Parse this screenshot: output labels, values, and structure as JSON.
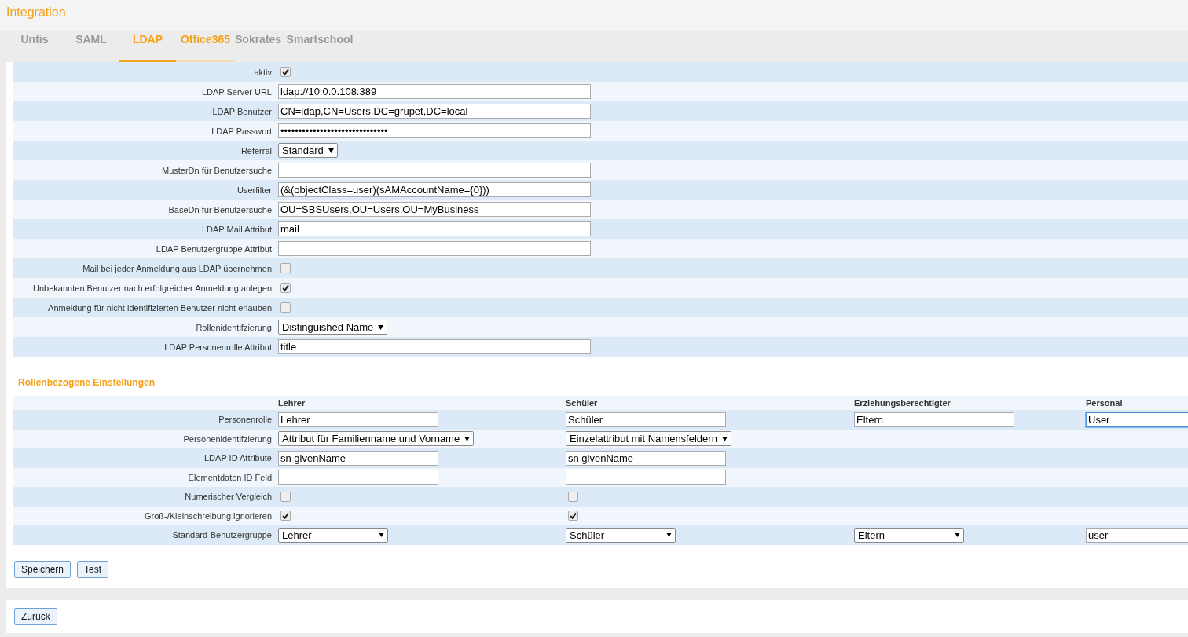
{
  "page_title": "Integration",
  "tabs": [
    {
      "label": "Untis",
      "selected": false,
      "highlighted": false
    },
    {
      "label": "SAML",
      "selected": false,
      "highlighted": false
    },
    {
      "label": "LDAP",
      "selected": true,
      "highlighted": true
    },
    {
      "label": "Office365",
      "selected": false,
      "highlighted": true
    },
    {
      "label": "Sokrates",
      "selected": false,
      "highlighted": false
    },
    {
      "label": "Smartschool",
      "selected": false,
      "highlighted": false
    }
  ],
  "settings": [
    {
      "label": "aktiv",
      "kind": "checkbox",
      "checked": true
    },
    {
      "label": "LDAP Server URL",
      "kind": "text",
      "value": "ldap://10.0.0.108:389"
    },
    {
      "label": "LDAP Benutzer",
      "kind": "text",
      "value": "CN=ldap,CN=Users,DC=grupet,DC=local"
    },
    {
      "label": "LDAP Passwort",
      "kind": "text",
      "value": "••••••••••••••••••••••••••••••"
    },
    {
      "label": "Referral",
      "kind": "select",
      "value": "Standard"
    },
    {
      "label": "MusterDn für Benutzersuche",
      "kind": "text"
    },
    {
      "label": "Userfilter",
      "kind": "text",
      "value": "(&(objectClass=user)(sAMAccountName={0}))"
    },
    {
      "label": "BaseDn für Benutzersuche",
      "kind": "text",
      "value": "OU=SBSUsers,OU=Users,OU=MyBusiness"
    },
    {
      "label": "LDAP Mail Attribut",
      "kind": "text",
      "value": "mail"
    },
    {
      "label": "LDAP Benutzergruppe Attribut",
      "kind": "text"
    },
    {
      "label": "Mail bei jeder Anmeldung aus LDAP übernehmen",
      "kind": "checkbox",
      "checked": false
    },
    {
      "label": "Unbekannten Benutzer nach erfolgreicher Anmeldung anlegen",
      "kind": "checkbox",
      "checked": true
    },
    {
      "label": "Anmeldung für nicht identifizierten Benutzer nicht erlauben",
      "kind": "checkbox",
      "checked": false
    },
    {
      "label": "Rollenidentifzierung",
      "kind": "select",
      "value": "Distinguished Name"
    },
    {
      "label": "LDAP Personenrolle Attribut",
      "kind": "text",
      "value": "title"
    }
  ],
  "role_section": {
    "title": "Rollenbezogene Einstellungen",
    "columns": [
      "Lehrer",
      "Schüler",
      "Erziehungsberechtigter",
      "Personal"
    ],
    "rows": [
      {
        "label": "Personenrolle",
        "cells": [
          {
            "kind": "text",
            "value": "Lehrer",
            "focused": false
          },
          {
            "kind": "text",
            "value": "Schüler",
            "focused": false
          },
          {
            "kind": "text",
            "value": "Eltern",
            "focused": false
          },
          {
            "kind": "text",
            "value": "User",
            "focused": true
          }
        ]
      },
      {
        "label": "Personenidentifzierung",
        "cells": [
          {
            "kind": "select",
            "value": "Attribut für Familienname und Vorname"
          },
          {
            "kind": "select",
            "value": "Einzelattribut mit Namensfeldern"
          },
          {
            "kind": "none"
          },
          {
            "kind": "none"
          }
        ]
      },
      {
        "label": "LDAP ID Attribute",
        "cells": [
          {
            "kind": "text",
            "value": "sn givenName",
            "focused": false
          },
          {
            "kind": "text",
            "value": "sn givenName",
            "focused": false
          },
          {
            "kind": "none"
          },
          {
            "kind": "none"
          }
        ]
      },
      {
        "label": "Elementdaten ID Feld",
        "cells": [
          {
            "kind": "text",
            "focused": false
          },
          {
            "kind": "text",
            "focused": false
          },
          {
            "kind": "none"
          },
          {
            "kind": "none"
          }
        ]
      },
      {
        "label": "Numerischer Vergleich",
        "cells": [
          {
            "kind": "checkbox",
            "checked": false
          },
          {
            "kind": "checkbox",
            "checked": false
          },
          {
            "kind": "none"
          },
          {
            "kind": "none"
          }
        ]
      },
      {
        "label": "Groß-/Kleinschreibung ignorieren",
        "cells": [
          {
            "kind": "checkbox",
            "checked": true
          },
          {
            "kind": "checkbox",
            "checked": true
          },
          {
            "kind": "none"
          },
          {
            "kind": "none"
          }
        ]
      },
      {
        "label": "Standard-Benutzergruppe",
        "cells": [
          {
            "kind": "select",
            "value": "Lehrer"
          },
          {
            "kind": "select",
            "value": "Schüler"
          },
          {
            "kind": "select",
            "value": "Eltern"
          },
          {
            "kind": "text",
            "value": "user",
            "focused": false
          }
        ]
      }
    ]
  },
  "buttons": [
    "Speichern",
    "Test"
  ],
  "back_button": "Zurück"
}
